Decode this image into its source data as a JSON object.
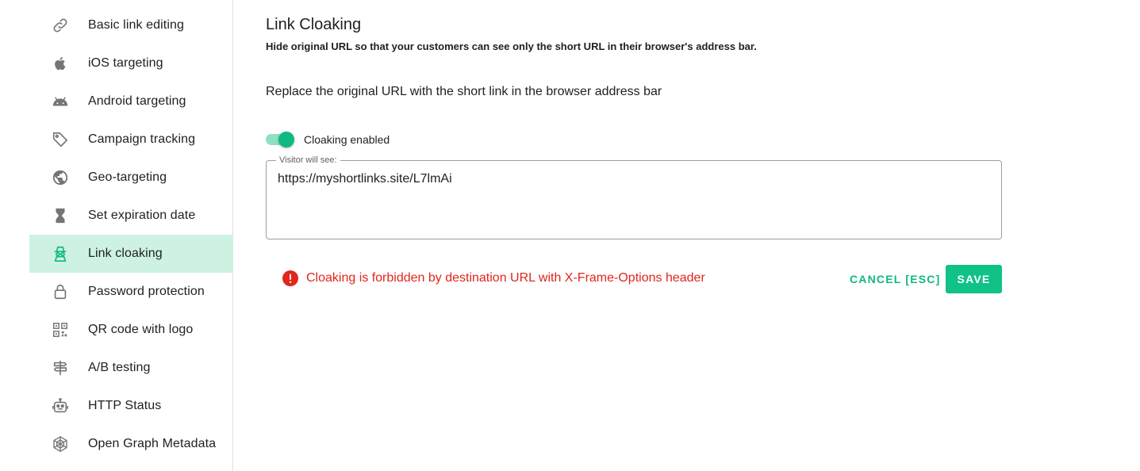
{
  "sidebar": {
    "items": [
      {
        "label": "Basic link editing",
        "icon": "link-icon"
      },
      {
        "label": "iOS targeting",
        "icon": "apple-icon"
      },
      {
        "label": "Android targeting",
        "icon": "android-icon"
      },
      {
        "label": "Campaign tracking",
        "icon": "tag-icon"
      },
      {
        "label": "Geo-targeting",
        "icon": "globe-icon"
      },
      {
        "label": "Set expiration date",
        "icon": "hourglass-icon"
      },
      {
        "label": "Link cloaking",
        "icon": "spy-icon",
        "active": true
      },
      {
        "label": "Password protection",
        "icon": "lock-icon"
      },
      {
        "label": "QR code with logo",
        "icon": "qr-code-icon"
      },
      {
        "label": "A/B testing",
        "icon": "signpost-icon"
      },
      {
        "label": "HTTP Status",
        "icon": "robot-icon"
      },
      {
        "label": "Open Graph Metadata",
        "icon": "web-icon"
      }
    ]
  },
  "main": {
    "title": "Link Cloaking",
    "subtitle": "Hide original URL so that your customers can see only the short URL in their browser's address bar.",
    "description": "Replace the original URL with the short link in the browser address bar",
    "toggle": {
      "label": "Cloaking enabled",
      "enabled": true
    },
    "visitor_field": {
      "legend": "Visitor will see:",
      "value": "https://myshortlinks.site/L7lmAi"
    },
    "error": "Cloaking is forbidden by destination URL with X-Frame-Options header",
    "actions": {
      "cancel_label": "CANCEL [ESC]",
      "save_label": "SAVE"
    }
  },
  "colors": {
    "accent": "#10b981",
    "active_bg": "#cdf2e2",
    "error": "#e0261d",
    "icon_gray": "#757575"
  }
}
